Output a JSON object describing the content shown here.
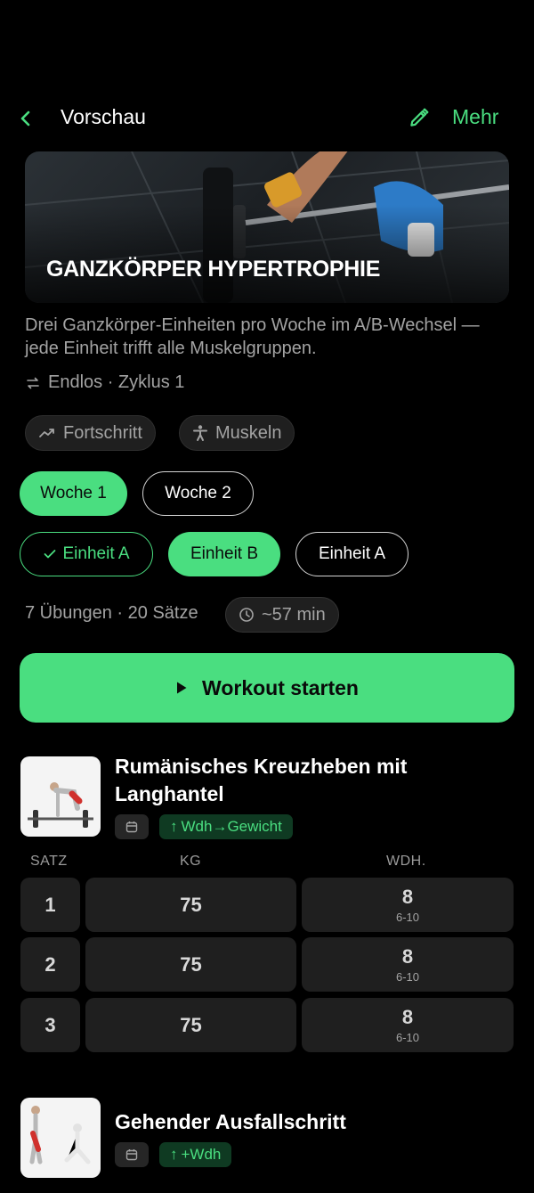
{
  "header": {
    "title": "Vorschau",
    "more_label": "Mehr"
  },
  "hero": {
    "title": "GANZKÖRPER HYPERTROPHIE"
  },
  "plan": {
    "description": "Drei Ganzkörper-Einheiten pro Woche im A/B-Wechsel — jede Einheit trifft alle Muskelgruppen.",
    "cycle_text": "Endlos · Zyklus 1"
  },
  "chips": {
    "progress": "Fortschritt",
    "muscles": "Muskeln"
  },
  "weeks": [
    {
      "label": "Woche 1",
      "selected": true
    },
    {
      "label": "Woche 2",
      "selected": false
    }
  ],
  "sessions": [
    {
      "label": "Einheit A",
      "state": "done"
    },
    {
      "label": "Einheit B",
      "state": "selected"
    },
    {
      "label": "Einheit A",
      "state": "default"
    }
  ],
  "summary": {
    "stats": "7 Übungen · 20 Sätze",
    "duration": "~57 min"
  },
  "start_button": {
    "label": "Workout starten"
  },
  "table_headers": {
    "set": "SATZ",
    "kg": "KG",
    "reps": "WDH."
  },
  "exercises": [
    {
      "name": "Rumänisches Kreuzheben mit Langhantel",
      "progression": "Wdh→Gewicht",
      "sets": [
        {
          "set": "1",
          "kg": "75",
          "reps": "8",
          "range": "6-10"
        },
        {
          "set": "2",
          "kg": "75",
          "reps": "8",
          "range": "6-10"
        },
        {
          "set": "3",
          "kg": "75",
          "reps": "8",
          "range": "6-10"
        }
      ]
    },
    {
      "name": "Gehender Ausfallschritt",
      "progression": "+Wdh"
    }
  ],
  "colors": {
    "accent": "#4ade80",
    "background": "#000000",
    "surface": "#1f1f1f"
  }
}
